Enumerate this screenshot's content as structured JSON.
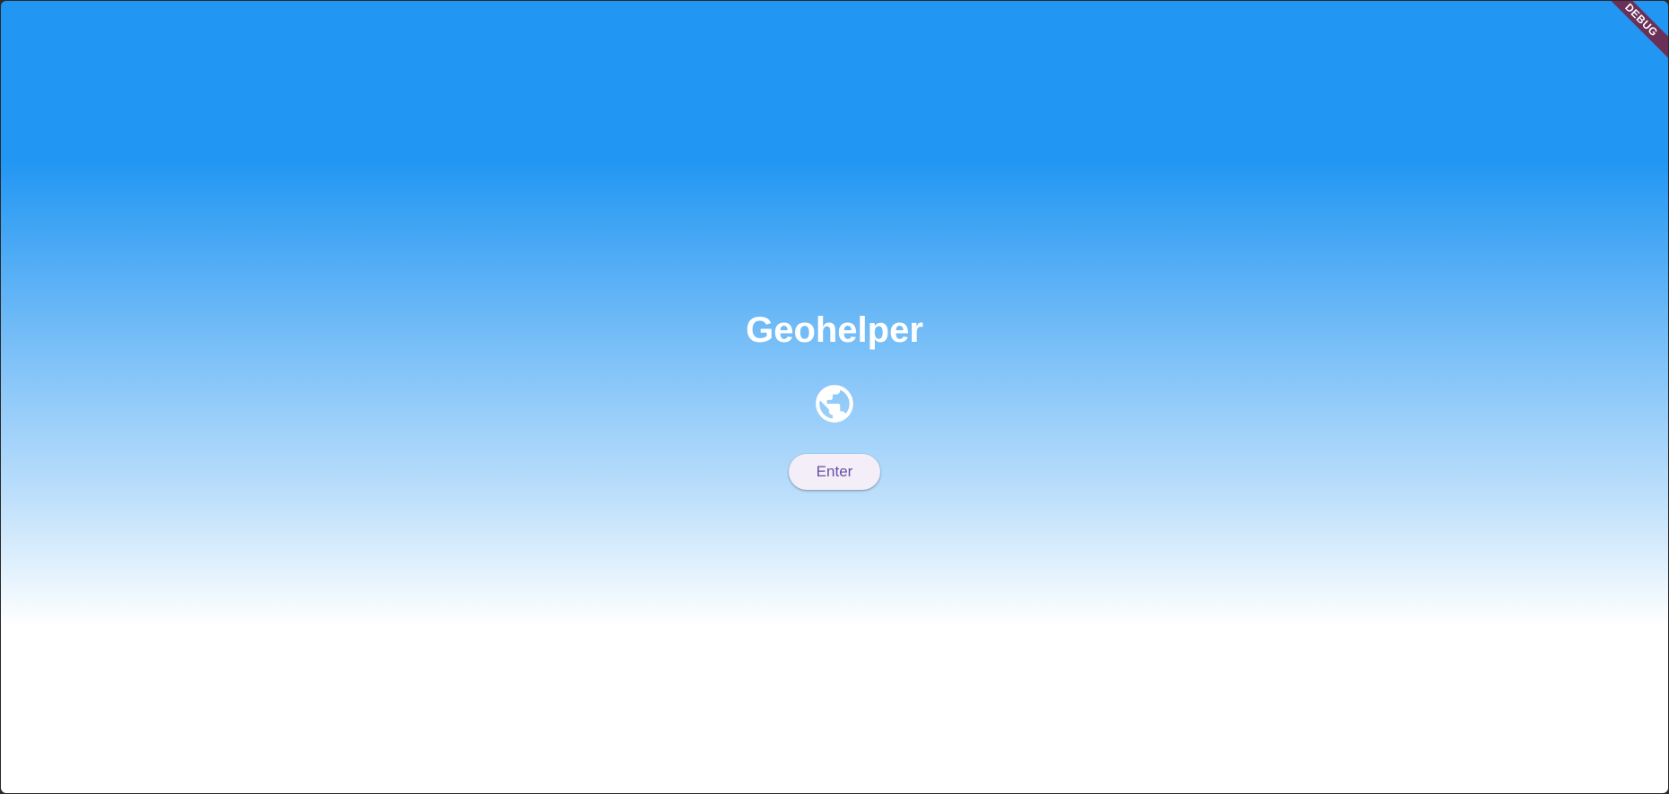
{
  "app": {
    "title": "Geohelper"
  },
  "main": {
    "icon": "globe-icon",
    "enter_label": "Enter"
  },
  "debug_banner": {
    "label": "DEBUG"
  },
  "colors": {
    "gradient_top": "#2196f3",
    "gradient_bottom": "#ffffff",
    "button_bg": "#f4eef8",
    "button_text": "#6750a4",
    "banner": "#7a1e3c"
  }
}
